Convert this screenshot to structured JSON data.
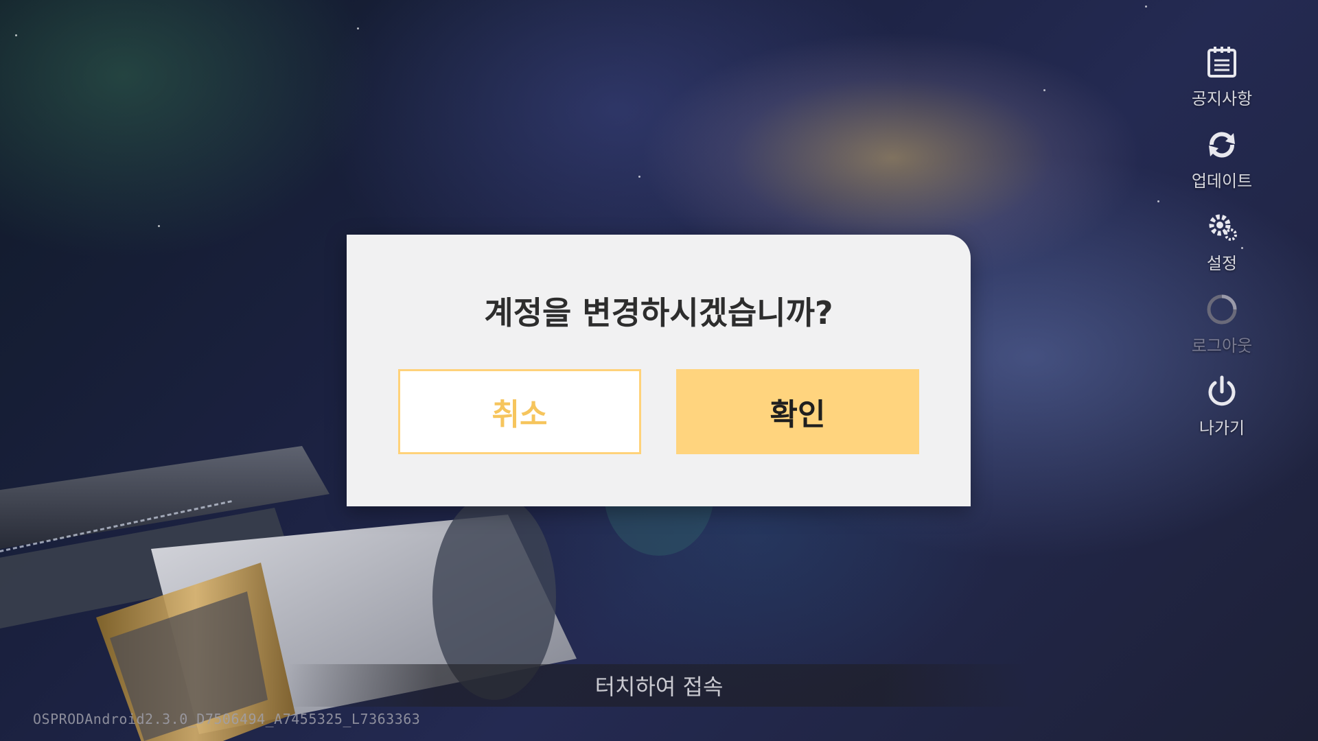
{
  "side_menu": {
    "items": [
      {
        "label": "공지사항",
        "icon": "notice-icon"
      },
      {
        "label": "업데이트",
        "icon": "update-icon"
      },
      {
        "label": "설정",
        "icon": "settings-icon"
      },
      {
        "label": "로그아웃",
        "icon": "logout-icon"
      },
      {
        "label": "나가기",
        "icon": "power-icon"
      }
    ]
  },
  "dialog": {
    "title": "계정을 변경하시겠습니까?",
    "cancel_label": "취소",
    "confirm_label": "확인"
  },
  "footer": {
    "touch_prompt": "터치하여 접속",
    "version": "OSPRODAndroid2.3.0_D7506494_A7455325_L7363363"
  },
  "colors": {
    "accent": "#ffd47e",
    "cancel_text": "#f6c55d",
    "dialog_bg": "#f1f1f2"
  }
}
